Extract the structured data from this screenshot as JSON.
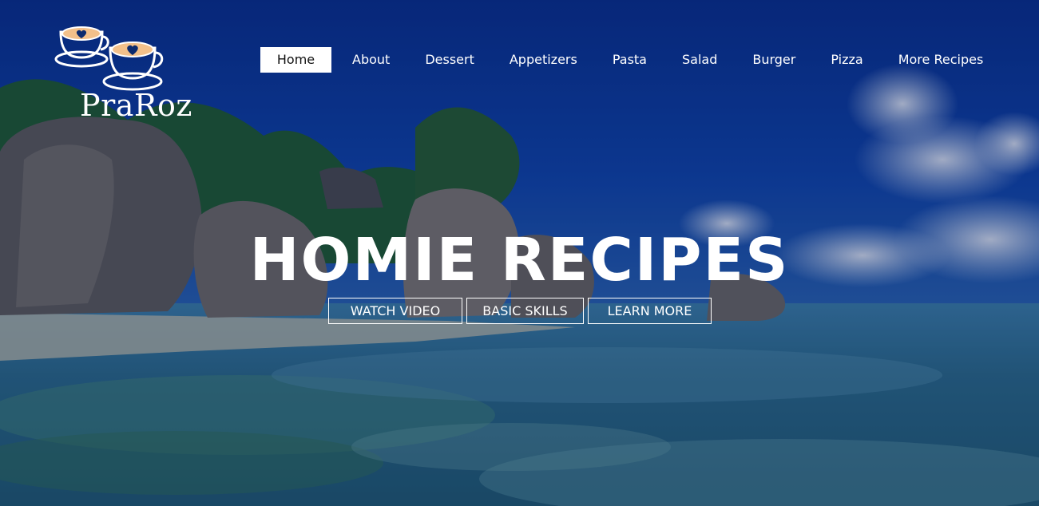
{
  "brand": {
    "name": "PraRoz",
    "icon": "coffee-cups-icon"
  },
  "nav": {
    "items": [
      {
        "label": "Home",
        "active": true
      },
      {
        "label": "About",
        "active": false
      },
      {
        "label": "Dessert",
        "active": false
      },
      {
        "label": "Appetizers",
        "active": false
      },
      {
        "label": "Pasta",
        "active": false
      },
      {
        "label": "Salad",
        "active": false
      },
      {
        "label": "Burger",
        "active": false
      },
      {
        "label": "Pizza",
        "active": false
      },
      {
        "label": "More Recipes",
        "active": false
      }
    ]
  },
  "hero": {
    "title": "HOMIE RECIPES",
    "buttons": [
      "WATCH VIDEO",
      "BASIC SKILLS",
      "LEARN MORE"
    ]
  },
  "colors": {
    "text": "#ffffff",
    "active_nav_bg": "#ffffff",
    "active_nav_text": "#111111",
    "logo_cup_fill": "#f2c08a"
  }
}
